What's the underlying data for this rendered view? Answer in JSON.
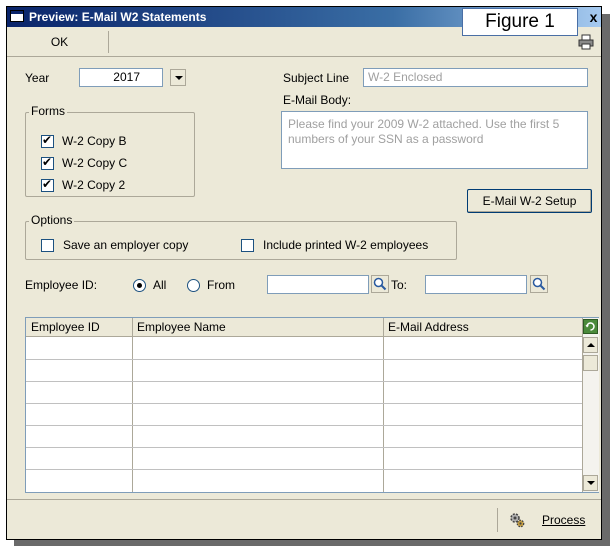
{
  "window": {
    "title": "Preview: E-Mail W2 Statements",
    "figure_label": "Figure 1",
    "close_glyph": "x"
  },
  "toolbar": {
    "ok_label": "OK"
  },
  "year": {
    "label": "Year",
    "value": "2017"
  },
  "subject": {
    "label": "Subject Line",
    "value": "W-2 Enclosed"
  },
  "body": {
    "label": "E-Mail Body:",
    "value": "Please find your 2009 W-2 attached.  Use the first 5 numbers of your SSN as a password"
  },
  "forms": {
    "title": "Forms",
    "items": [
      {
        "label": "W-2 Copy B",
        "checked": true
      },
      {
        "label": "W-2 Copy C",
        "checked": true
      },
      {
        "label": "W-2 Copy 2",
        "checked": true
      }
    ]
  },
  "setup_button": {
    "label": "E-Mail W-2 Setup"
  },
  "options": {
    "title": "Options",
    "save_employer_copy": {
      "label": "Save an employer copy",
      "checked": false
    },
    "include_printed": {
      "label": "Include printed W-2 employees",
      "checked": false
    }
  },
  "employee_filter": {
    "label": "Employee ID:",
    "all_label": "All",
    "from_label": "From",
    "to_label": "To:",
    "selected": "All",
    "from_value": "",
    "to_value": ""
  },
  "grid": {
    "columns": [
      "Employee ID",
      "Employee Name",
      "E-Mail Address"
    ],
    "rows": []
  },
  "footer": {
    "process_label": "Process"
  }
}
